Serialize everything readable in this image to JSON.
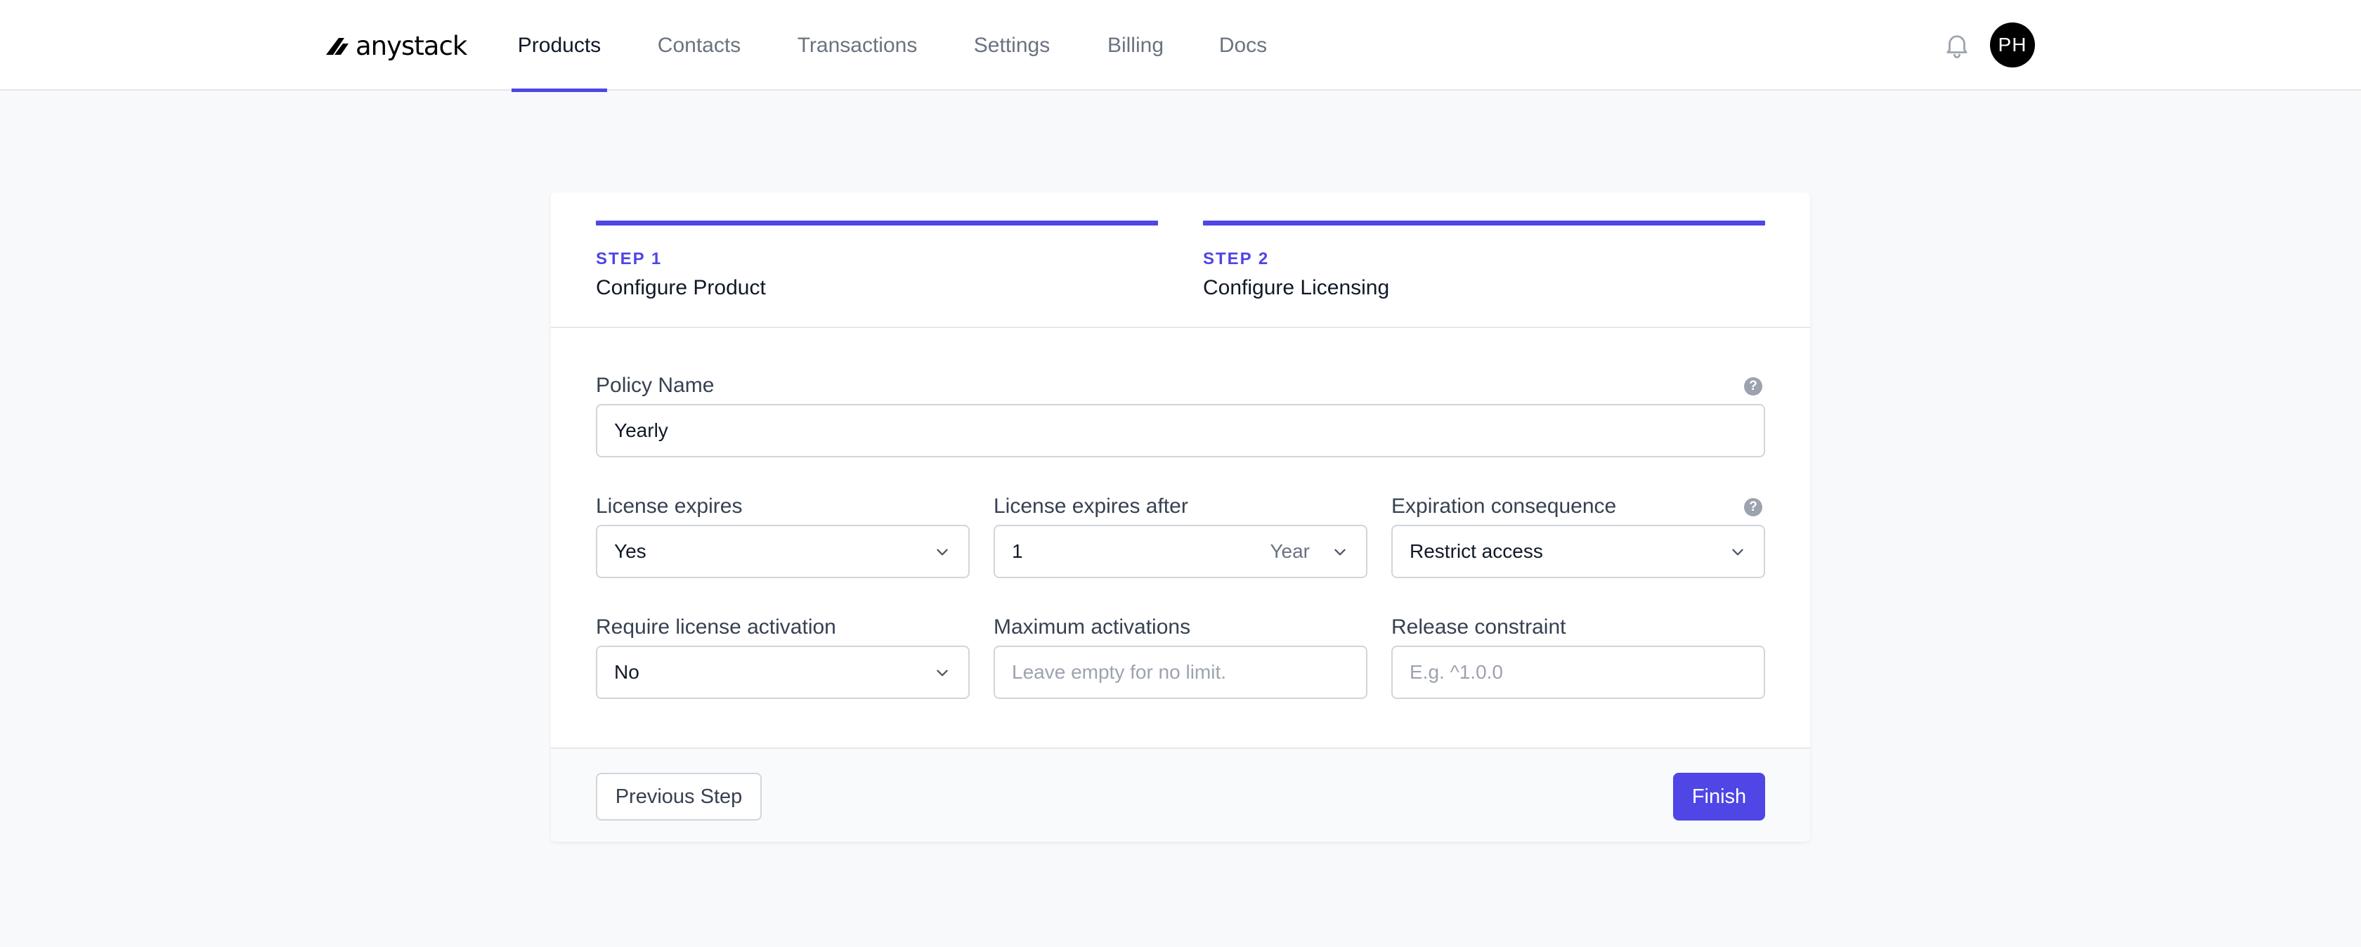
{
  "brand": {
    "name": "anystack",
    "accent": "#4f46e5"
  },
  "nav": {
    "items": [
      {
        "label": "Products",
        "active": true
      },
      {
        "label": "Contacts"
      },
      {
        "label": "Transactions"
      },
      {
        "label": "Settings"
      },
      {
        "label": "Billing"
      },
      {
        "label": "Docs"
      }
    ],
    "notifications_icon": "bell-icon",
    "avatar_initials": "PH"
  },
  "steps": [
    {
      "number": "STEP 1",
      "title": "Configure Product"
    },
    {
      "number": "STEP 2",
      "title": "Configure Licensing"
    }
  ],
  "form": {
    "policy_name": {
      "label": "Policy Name",
      "value": "Yearly",
      "help_icon": "question-icon"
    },
    "license_expires": {
      "label": "License expires",
      "value": "Yes"
    },
    "license_expires_after": {
      "label": "License expires after",
      "value": "1",
      "unit": "Year"
    },
    "expiration_consequence": {
      "label": "Expiration consequence",
      "value": "Restrict access",
      "help_icon": "question-icon"
    },
    "require_activation": {
      "label": "Require license activation",
      "value": "No"
    },
    "max_activations": {
      "label": "Maximum activations",
      "value": "",
      "placeholder": "Leave empty for no limit."
    },
    "release_constraint": {
      "label": "Release constraint",
      "value": "",
      "placeholder": "E.g. ^1.0.0"
    }
  },
  "actions": {
    "previous": "Previous Step",
    "finish": "Finish"
  }
}
